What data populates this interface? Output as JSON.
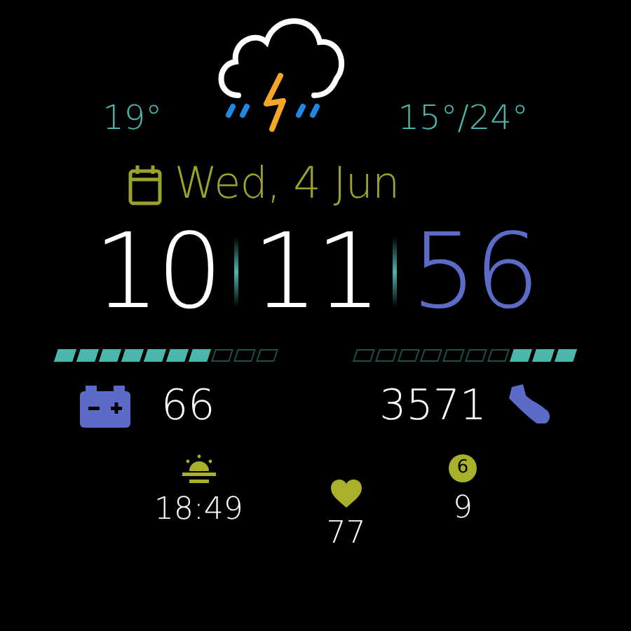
{
  "weather": {
    "current_temp": "19°",
    "range": "15°/24°"
  },
  "date": "Wed, 4 Jun",
  "time": {
    "hours": "10",
    "minutes": "11",
    "seconds": "56"
  },
  "battery": {
    "level": 0.7,
    "value": "66"
  },
  "steps": {
    "level": 0.3,
    "value": "3571"
  },
  "sunset": {
    "time": "18:49"
  },
  "heart_rate": {
    "value": "77"
  },
  "notifications": {
    "badge": "6",
    "value": "9"
  }
}
